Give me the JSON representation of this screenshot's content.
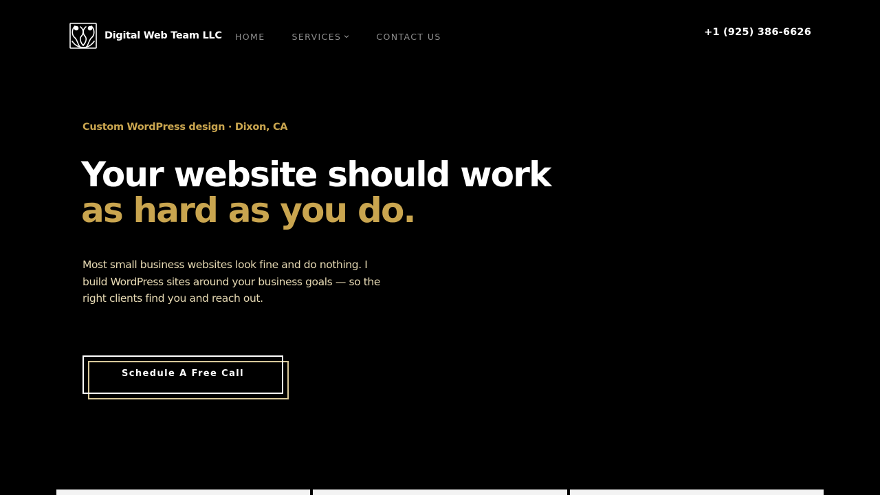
{
  "header": {
    "brand_name": "Digital Web Team LLC",
    "logo_icon": "brain-split-face-logo-icon",
    "nav": [
      {
        "label": "HOME"
      },
      {
        "label": "SERVICES"
      },
      {
        "label": "CONTACT US"
      }
    ],
    "phone": "+1 (925) 386-6626"
  },
  "hero": {
    "eyebrow": "Custom WordPress design · Dixon, CA",
    "headline_line1": "Your website should work",
    "headline_line2": "as hard as you do.",
    "lead": "Most small business websites look fine and do nothing. I build WordPress sites around your business goals — so the right clients find you and reach out.",
    "cta_label": "Schedule A Free Call"
  },
  "colors": {
    "background": "#000000",
    "accent_gold": "#c9a54f",
    "lead_text": "#e6d9b3",
    "nav_text": "#8e8e8e",
    "cta_border": "#ffffff",
    "cta_shadow_border": "#d8c89a"
  }
}
